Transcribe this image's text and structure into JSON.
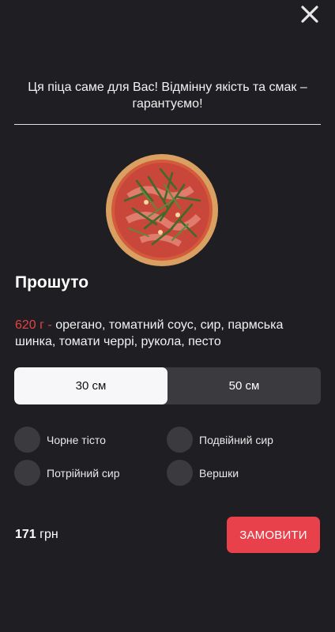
{
  "tagline": "Ця піца саме для Вас! Відмінну якість та смак – гарантуємо!",
  "product": {
    "name": "Прошуто",
    "weight": "620 г -",
    "ingredients": "орегано, томатний соус, сир, пармська шинка, томати черрі, рукола, песто"
  },
  "sizes": [
    {
      "label": "30 см",
      "selected": true
    },
    {
      "label": "50 см",
      "selected": false
    }
  ],
  "options": [
    {
      "label": "Чорне тісто"
    },
    {
      "label": "Подвійний сир"
    },
    {
      "label": "Потрійний сир"
    },
    {
      "label": "Вершки"
    }
  ],
  "price": {
    "amount": "171",
    "currency": "грн"
  },
  "order_button": "ЗАМОВИТИ",
  "colors": {
    "background": "#1f1f23",
    "accent": "#e9414b",
    "weight": "#e54343",
    "segment_bg": "#3b3b3f",
    "segment_active": "#f7f7f9"
  },
  "icons": {
    "close": "close-icon",
    "pizza": "pizza-image"
  }
}
